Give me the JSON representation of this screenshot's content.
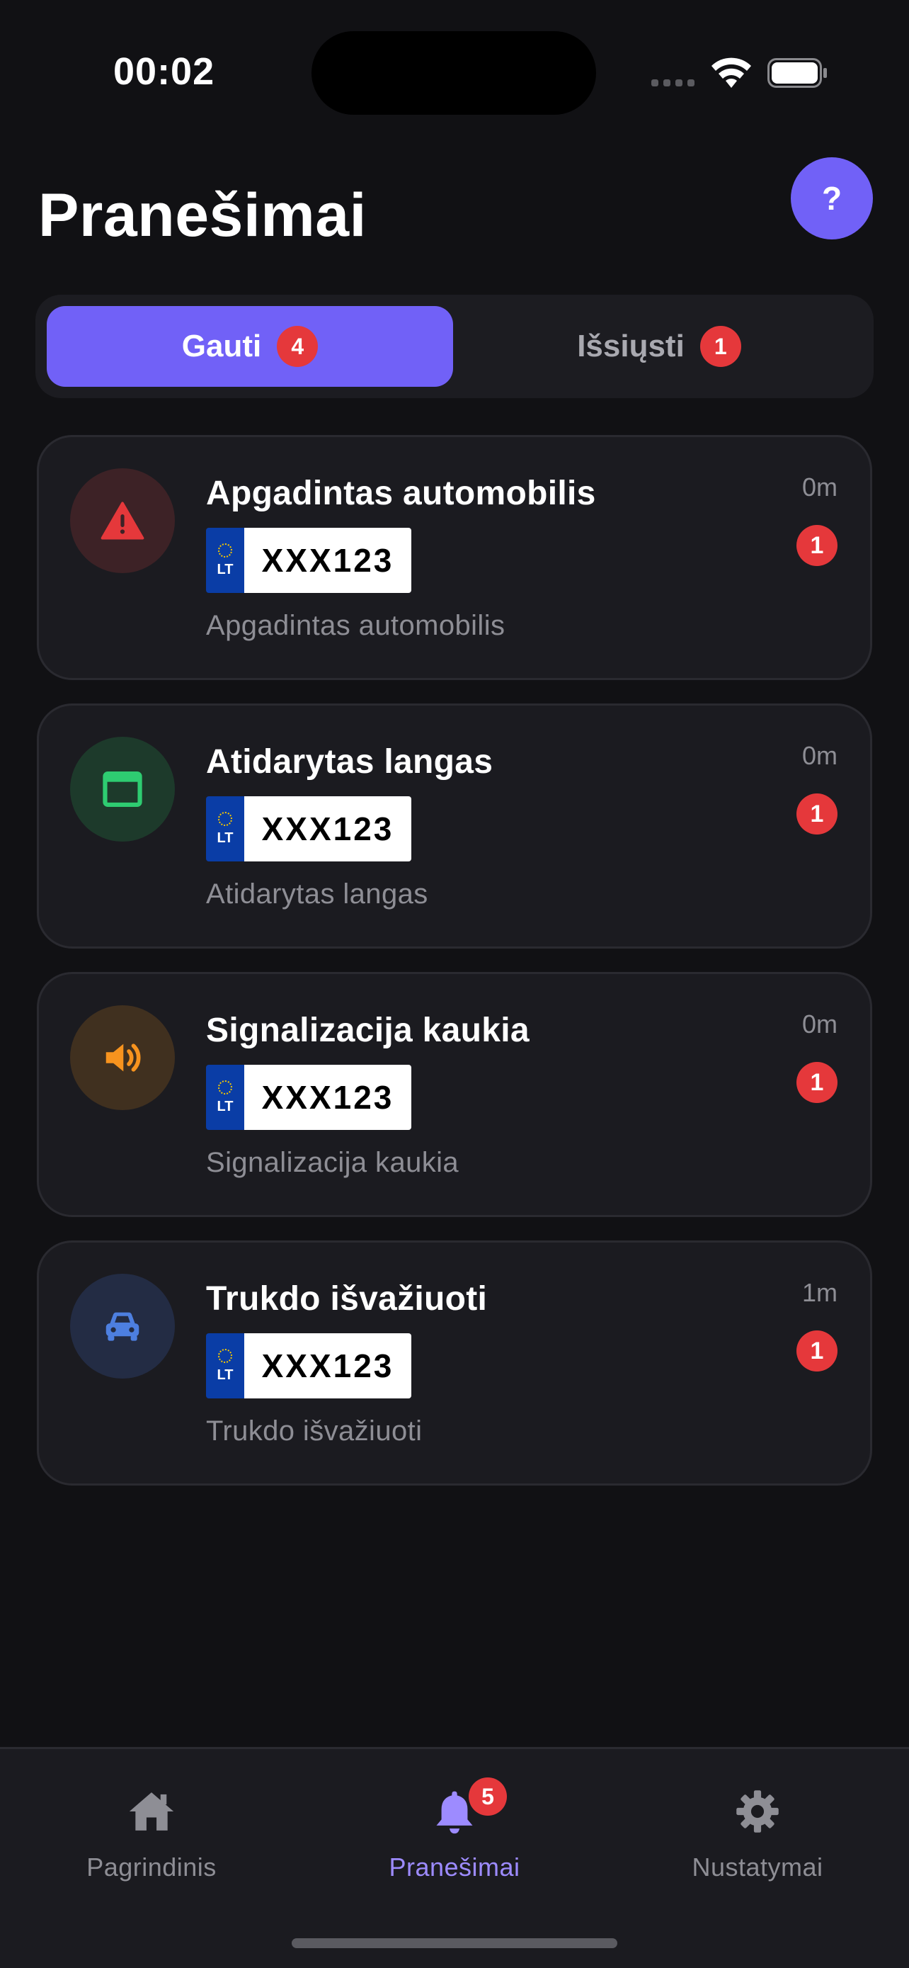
{
  "status_bar": {
    "time": "00:02"
  },
  "header": {
    "title": "Pranešimai",
    "help_label": "?"
  },
  "segments": [
    {
      "label": "Gauti",
      "count": "4",
      "active": true
    },
    {
      "label": "Išsiųsti",
      "count": "1",
      "active": false
    }
  ],
  "notifications": [
    {
      "title": "Apgadintas automobilis",
      "plate_country": "LT",
      "plate": "XXX123",
      "description": "Apgadintas automobilis",
      "time": "0m",
      "count": "1",
      "icon": "warning-icon",
      "icon_color": "#e5383b",
      "icon_bg": "#3d2226"
    },
    {
      "title": "Atidarytas langas",
      "plate_country": "LT",
      "plate": "XXX123",
      "description": "Atidarytas langas",
      "time": "0m",
      "count": "1",
      "icon": "window-icon",
      "icon_color": "#2ecc71",
      "icon_bg": "#1d3a2b"
    },
    {
      "title": "Signalizacija kaukia",
      "plate_country": "LT",
      "plate": "XXX123",
      "description": "Signalizacija kaukia",
      "time": "0m",
      "count": "1",
      "icon": "speaker-icon",
      "icon_color": "#f7931e",
      "icon_bg": "#40301f"
    },
    {
      "title": "Trukdo išvažiuoti",
      "plate_country": "LT",
      "plate": "XXX123",
      "description": "Trukdo išvažiuoti",
      "time": "1m",
      "count": "1",
      "icon": "car-icon",
      "icon_color": "#4d7fe0",
      "icon_bg": "#232c44"
    }
  ],
  "tab_bar": {
    "items": [
      {
        "label": "Pagrindinis",
        "icon": "home-icon",
        "active": false
      },
      {
        "label": "Pranešimai",
        "icon": "bell-icon",
        "active": true,
        "badge": "5"
      },
      {
        "label": "Nustatymai",
        "icon": "gear-icon",
        "active": false
      }
    ]
  },
  "colors": {
    "accent": "#7161f7",
    "badge": "#e5383b",
    "background": "#111114",
    "card": "#1b1b20"
  }
}
